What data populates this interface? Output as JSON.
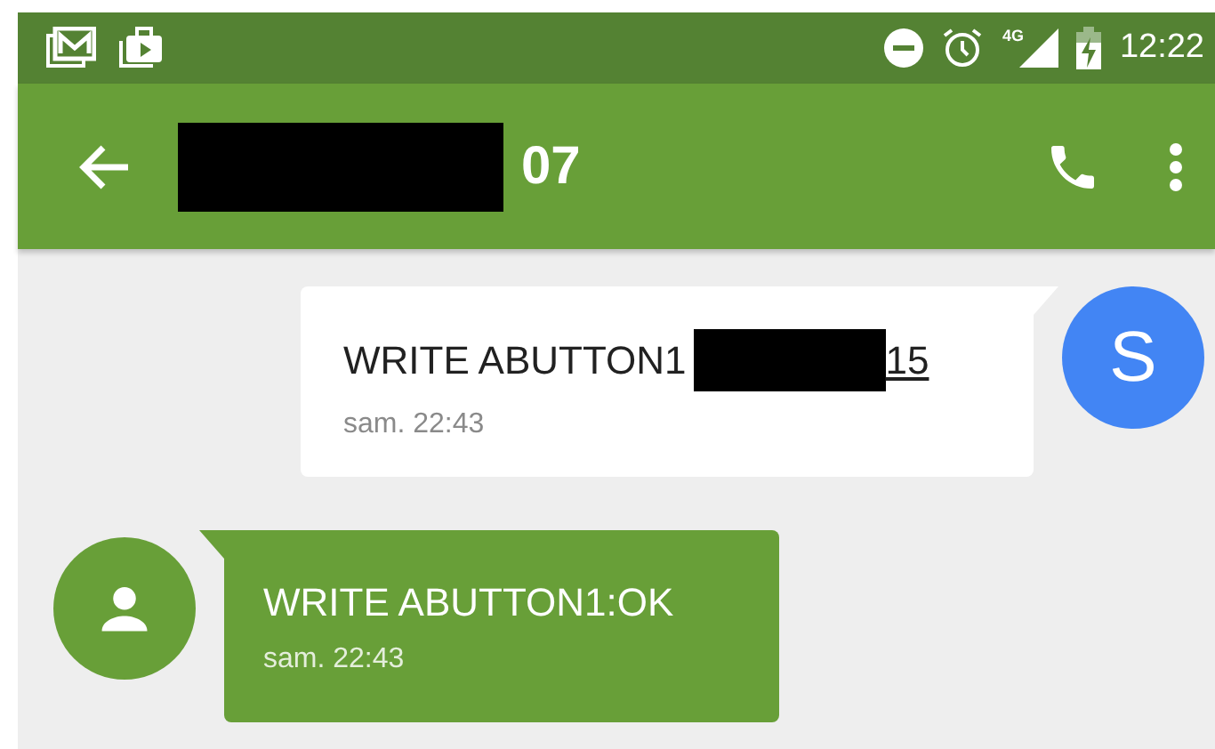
{
  "status_bar": {
    "network": "4G",
    "time": "12:22"
  },
  "app_bar": {
    "title_redacted": true,
    "title": "07"
  },
  "messages": [
    {
      "kind": "outgoing",
      "avatar_letter": "S",
      "text": "WRITE ABUTTON1",
      "redacted": true,
      "link_text": "15",
      "timestamp": "sam. 22:43"
    },
    {
      "kind": "incoming",
      "text": "WRITE ABUTTON1:OK",
      "redacted": false,
      "timestamp": "sam. 22:43"
    }
  ]
}
